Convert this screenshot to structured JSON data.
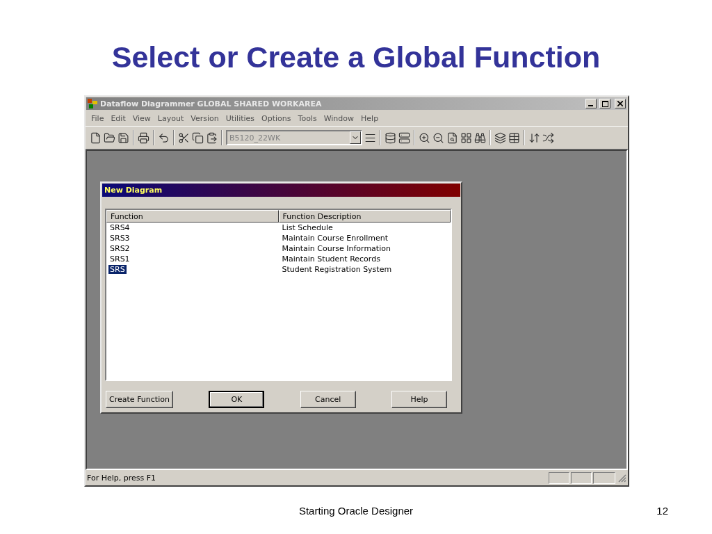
{
  "slide": {
    "title": "Select or Create a Global Function",
    "footer": "Starting Oracle Designer",
    "page_number": "12"
  },
  "window": {
    "title": "Dataflow Diagrammer GLOBAL SHARED WORKAREA"
  },
  "menu": [
    "File",
    "Edit",
    "View",
    "Layout",
    "Version",
    "Utilities",
    "Options",
    "Tools",
    "Window",
    "Help"
  ],
  "toolbar": {
    "combo": {
      "value": "B5120_22WK",
      "disabled": true
    }
  },
  "dialog": {
    "title": "New Diagram",
    "columns": [
      "Function",
      "Function Description"
    ],
    "rows": [
      {
        "function": "SRS4",
        "description": "List Schedule",
        "selected": false
      },
      {
        "function": "SRS3",
        "description": "Maintain Course Enrollment",
        "selected": false
      },
      {
        "function": "SRS2",
        "description": "Maintain Course Information",
        "selected": false
      },
      {
        "function": "SRS1",
        "description": "Maintain Student Records",
        "selected": false
      },
      {
        "function": "SRS",
        "description": "Student Registration System",
        "selected": true
      }
    ],
    "buttons": [
      {
        "label": "Create Function",
        "default": false
      },
      {
        "label": "OK",
        "default": true
      },
      {
        "label": "Cancel",
        "default": false
      },
      {
        "label": "Help",
        "default": false
      }
    ]
  },
  "status_bar": {
    "text": "For Help, press F1"
  }
}
